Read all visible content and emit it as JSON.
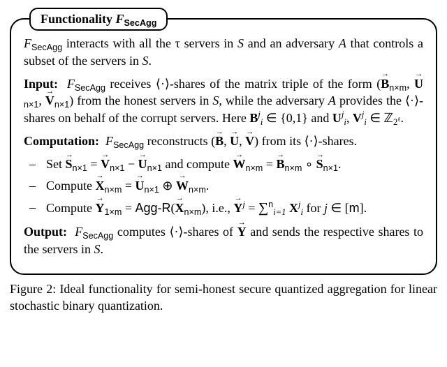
{
  "box": {
    "title_prefix": "Functionality ",
    "title_func": "F",
    "title_sub": "SecAgg",
    "p1_a": "F",
    "p1_b": "SecAgg",
    "p1_c": " interacts with all the τ servers in ",
    "p1_d": "S",
    "p1_e": " and an adversary ",
    "p1_f": "A",
    "p1_g": " that controls a subset of the servers in ",
    "p1_h": "S",
    "p1_i": ".",
    "input_label": "Input:",
    "p2_a": "F",
    "p2_b": "SecAgg",
    "p2_c": " receives ⟨·⟩-shares of the matrix triple of the form (",
    "p2_v1": "B",
    "p2_v1sub": "n×m",
    "p2_comma1": ", ",
    "p2_v2": "U",
    "p2_v2sub": "n×1",
    "p2_comma2": ", ",
    "p2_v3": "V",
    "p2_v3sub": "n×1",
    "p2_d": ") from the honest servers in ",
    "p2_e": "S",
    "p2_f": ", while the adversary ",
    "p2_g": "A",
    "p2_h": " provides the ⟨·⟩-shares on behalf of the corrupt servers. Here ",
    "p2_i": "B",
    "p2_i_sup": "j",
    "p2_i_sub": "i",
    "p2_j": " ∈ {0,1} and ",
    "p2_k": "U",
    "p2_k_sup": "j",
    "p2_k_sub": "i",
    "p2_comma3": ", ",
    "p2_l": "V",
    "p2_l_sup": "j",
    "p2_l_sub": "i",
    "p2_m": " ∈ ",
    "p2_ring": "ℤ",
    "p2_ring_sub": "2",
    "p2_ring_sup": "ℓ",
    "p2_n": ".",
    "comp_label": "Computation:",
    "p3_a": "F",
    "p3_b": "SecAgg",
    "p3_c": " reconstructs (",
    "p3_v1": "B",
    "p3_comma1": ", ",
    "p3_v2": "U",
    "p3_comma2": ", ",
    "p3_v3": "V",
    "p3_d": ") from its ⟨·⟩-shares.",
    "li1_a": "Set ",
    "li1_s": "S",
    "li1_s_sub": "n×1",
    "li1_eq": " = ",
    "li1_v": "V",
    "li1_v_sub": "n×1",
    "li1_minus": " − ",
    "li1_u": "U",
    "li1_u_sub": "n×1",
    "li1_b": " and compute ",
    "li1_w": "W",
    "li1_w_sub": "n×m",
    "li1_eq2": " = ",
    "li1_bm": "B",
    "li1_bm_sub": "n×m",
    "li1_circ": " ∘ ",
    "li1_s2": "S",
    "li1_s2_sub": "n×1",
    "li1_end": ".",
    "li2_a": "Compute ",
    "li2_x": "X",
    "li2_x_sub": "n×m",
    "li2_eq": " = ",
    "li2_u": "U",
    "li2_u_sub": "n×1",
    "li2_plus": " ⊕ ",
    "li2_w": "W",
    "li2_w_sub": "n×m",
    "li2_end": ".",
    "li3_a": "Compute ",
    "li3_y": "Y",
    "li3_y_sub": "1×m",
    "li3_eq": " = ",
    "li3_agg": "Agg-R",
    "li3_open": "(",
    "li3_x": "X",
    "li3_x_sub": "n×m",
    "li3_close": "), i.e., ",
    "li3_y2": "Y",
    "li3_y2_sup": "j",
    "li3_eq2": " = ",
    "li3_sum": "∑",
    "li3_sum_sub": "i=1",
    "li3_sum_sup": "n",
    "li3_xi": " X",
    "li3_xi_sup": "j",
    "li3_xi_sub": "i",
    "li3_for": " for ",
    "li3_j": "j",
    "li3_in": " ∈ [",
    "li3_m": "m",
    "li3_end": "].",
    "out_label": "Output:",
    "p4_a": "F",
    "p4_b": "SecAgg",
    "p4_c": " computes ⟨·⟩-shares of ",
    "p4_y": "Y",
    "p4_d": " and sends the respective shares to the servers in ",
    "p4_e": "S",
    "p4_f": "."
  },
  "caption": {
    "label": "Figure 2: ",
    "text": "Ideal functionality for semi-honest secure quantized aggregation for linear stochastic binary quantization."
  }
}
